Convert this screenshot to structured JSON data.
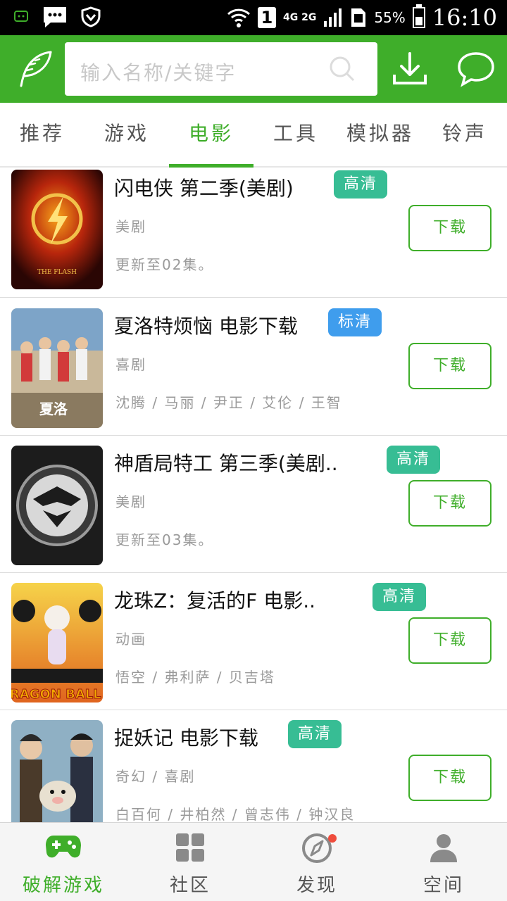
{
  "status_bar": {
    "network": "4G 2G",
    "sim": "1",
    "battery": "55%",
    "battery_level": 0.55,
    "time": "16:10"
  },
  "header": {
    "search_placeholder": "输入名称/关键字",
    "icons": [
      "feather-logo-icon",
      "search-icon",
      "download-icon",
      "chat-bubble-icon"
    ],
    "accent_color": "#3fae2a"
  },
  "tabs": [
    {
      "label": "推荐"
    },
    {
      "label": "游戏"
    },
    {
      "label": "电影",
      "active": true
    },
    {
      "label": "工具"
    },
    {
      "label": "模拟器"
    },
    {
      "label": "铃声"
    }
  ],
  "items": [
    {
      "title": "闪电侠  第二季(美剧)",
      "badge": "高清",
      "badge_type": "hd",
      "genre": "美剧",
      "extra": "更新至02集。",
      "download": "下载",
      "thumb": "flash-poster"
    },
    {
      "title": "夏洛特烦恼  电影下载",
      "badge": "标清",
      "badge_type": "sd",
      "genre": "喜剧",
      "extra": "沈腾 / 马丽 / 尹正 / 艾伦 / 王智",
      "download": "下载",
      "thumb": "charlotte-poster"
    },
    {
      "title": "神盾局特工  第三季(美剧..",
      "badge": "高清",
      "badge_type": "hd",
      "genre": "美剧",
      "extra": "更新至03集。",
      "download": "下载",
      "thumb": "shield-logo-poster"
    },
    {
      "title": "龙珠Z：复活的F    电影..",
      "badge": "高清",
      "badge_type": "hd",
      "genre": "动画",
      "extra": "悟空 / 弗利萨 / 贝吉塔",
      "download": "下载",
      "thumb": "dragonball-poster"
    },
    {
      "title": "捉妖记  电影下载",
      "badge": "高清",
      "badge_type": "hd",
      "genre": "奇幻 / 喜剧",
      "extra": "白百何 / 井柏然 / 曾志伟 / 钟汉良",
      "download": "下载",
      "thumb": "monster-hunt-poster"
    }
  ],
  "bottom_nav": [
    {
      "label": "破解游戏",
      "icon": "gamepad-icon",
      "active": true
    },
    {
      "label": "社区",
      "icon": "grid-icon"
    },
    {
      "label": "发现",
      "icon": "compass-icon",
      "badge_dot": true
    },
    {
      "label": "空间",
      "icon": "person-icon"
    }
  ]
}
